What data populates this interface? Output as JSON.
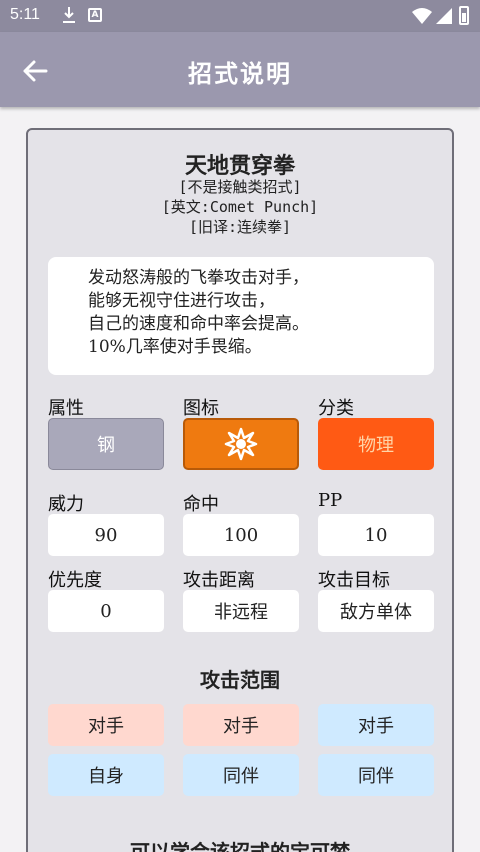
{
  "status_bar": {
    "time": "5:11"
  },
  "app_bar": {
    "title": "招式说明"
  },
  "move": {
    "name": "天地贯穿拳",
    "contact": "[不是接触类招式]",
    "english": "[英文:Comet Punch]",
    "old_name": "[旧译:连续拳]"
  },
  "description": {
    "lines": [
      "发动怒涛般的飞拳攻击对手，",
      "能够无视守住进行攻击，",
      "自己的速度和命中率会提高。",
      "10%几率使对手畏缩。"
    ]
  },
  "stats": {
    "type_label": "属性",
    "type_value": "钢",
    "icon_label": "图标",
    "category_label": "分类",
    "category_value": "物理",
    "power_label": "威力",
    "power_value": "90",
    "accuracy_label": "命中",
    "accuracy_value": "100",
    "pp_label": "PP",
    "pp_value": "10",
    "priority_label": "优先度",
    "priority_value": "0",
    "distance_label": "攻击距离",
    "distance_value": "非远程",
    "target_label": "攻击目标",
    "target_value": "敌方单体"
  },
  "range": {
    "title": "攻击范围",
    "cells": [
      "对手",
      "对手",
      "对手",
      "自身",
      "同伴",
      "同伴"
    ]
  },
  "learn": {
    "title": "可以学会该招式的宝可梦"
  },
  "colors": {
    "status_bar": "#8d8a9e",
    "app_bar": "#9b98ae",
    "type_steel": "#a9a8ba",
    "icon_tile": "#ef7a10",
    "physical": "#ff5a14",
    "range_foe": "#ffd8cf",
    "range_ally": "#cfeaff"
  },
  "icons": {
    "back": "arrow-left-icon",
    "move_icon": "starburst-icon"
  }
}
